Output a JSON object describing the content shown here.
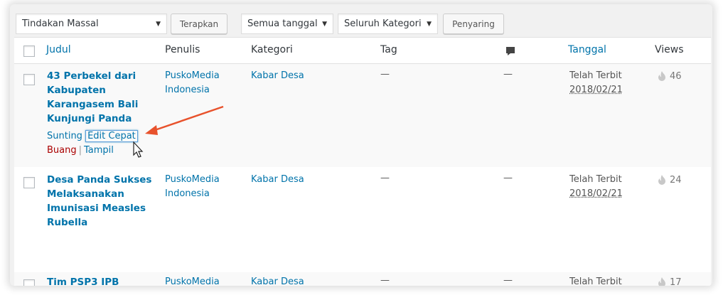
{
  "toolbar": {
    "bulk_action": "Tindakan Massal",
    "apply_button": "Terapkan",
    "date_filter": "Semua tanggal",
    "category_filter": "Seluruh Kategori",
    "filter_button": "Penyaring"
  },
  "columns": {
    "title": "Judul",
    "author": "Penulis",
    "categories": "Kategori",
    "tags": "Tag",
    "comments_icon": "comment-bubble-icon",
    "date": "Tanggal",
    "views": "Views"
  },
  "row_actions": {
    "edit": "Sunting",
    "quick_edit": "Edit Cepat",
    "trash": "Buang",
    "view": "Tampil",
    "separator": "|"
  },
  "posts": [
    {
      "title": "43 Perbekel dari Kabupaten Karangasem Bali Kunjungi Panda",
      "author": "PuskoMedia Indonesia",
      "category": "Kabar Desa",
      "tags": "—",
      "comments": "—",
      "status": "Telah Terbit",
      "date": "2018/02/21",
      "views": "46"
    },
    {
      "title": "Desa Panda Sukses Melaksanakan Imunisasi Measles Rubella",
      "author": "PuskoMedia Indonesia",
      "category": "Kabar Desa",
      "tags": "—",
      "comments": "—",
      "status": "Telah Terbit",
      "date": "2018/02/21",
      "views": "24"
    },
    {
      "title": "Tim PSP3 IPB",
      "author": "PuskoMedia",
      "category": "Kabar Desa",
      "tags": "—",
      "comments": "—",
      "status": "Telah Terbit",
      "views": "17"
    }
  ],
  "colors": {
    "link": "#0073aa",
    "trash": "#aa0000",
    "annotation_arrow": "#e8522c"
  }
}
